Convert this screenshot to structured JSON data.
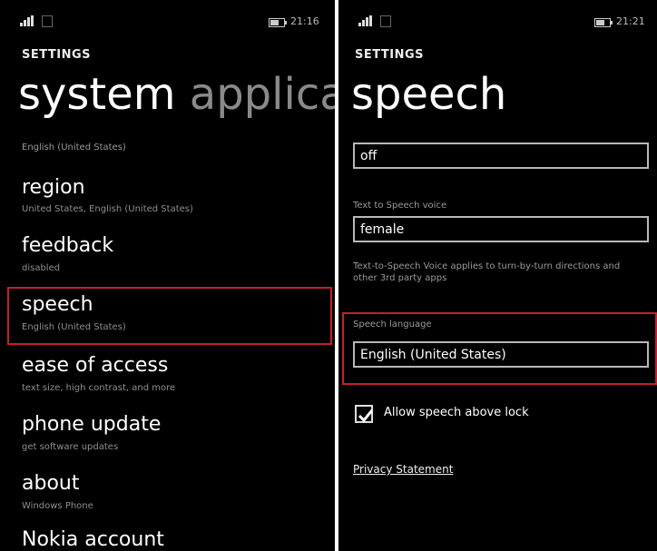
{
  "left": {
    "status": {
      "time": "21:16"
    },
    "header": {
      "label": "SETTINGS"
    },
    "pivot": {
      "current": "system",
      "next": "applica"
    },
    "top_subtitle": "English (United States)",
    "items": [
      {
        "title": "region",
        "subtitle": "United States, English (United States)"
      },
      {
        "title": "feedback",
        "subtitle": "disabled"
      },
      {
        "title": "speech",
        "subtitle": "English (United States)"
      },
      {
        "title": "ease of access",
        "subtitle": "text size, high contrast, and more"
      },
      {
        "title": "phone update",
        "subtitle": "get software updates"
      },
      {
        "title": "about",
        "subtitle": "Windows Phone"
      },
      {
        "title": "Nokia account",
        "subtitle": ""
      }
    ]
  },
  "right": {
    "status": {
      "time": "21:21"
    },
    "header": {
      "label": "SETTINGS"
    },
    "title": "speech",
    "recognition_value": "off",
    "voice": {
      "label": "Text to Speech voice",
      "value": "female"
    },
    "voice_note": "Text-to-Speech Voice applies to turn-by-turn directions and other 3rd party apps",
    "language": {
      "label": "Speech language",
      "value": "English (United States)"
    },
    "checkbox": {
      "label": "Allow speech above lock",
      "checked": true
    },
    "privacy_link": "Privacy Statement"
  },
  "colors": {
    "highlight": "#c3202e",
    "background": "#000000",
    "divider": "#ffffff"
  }
}
